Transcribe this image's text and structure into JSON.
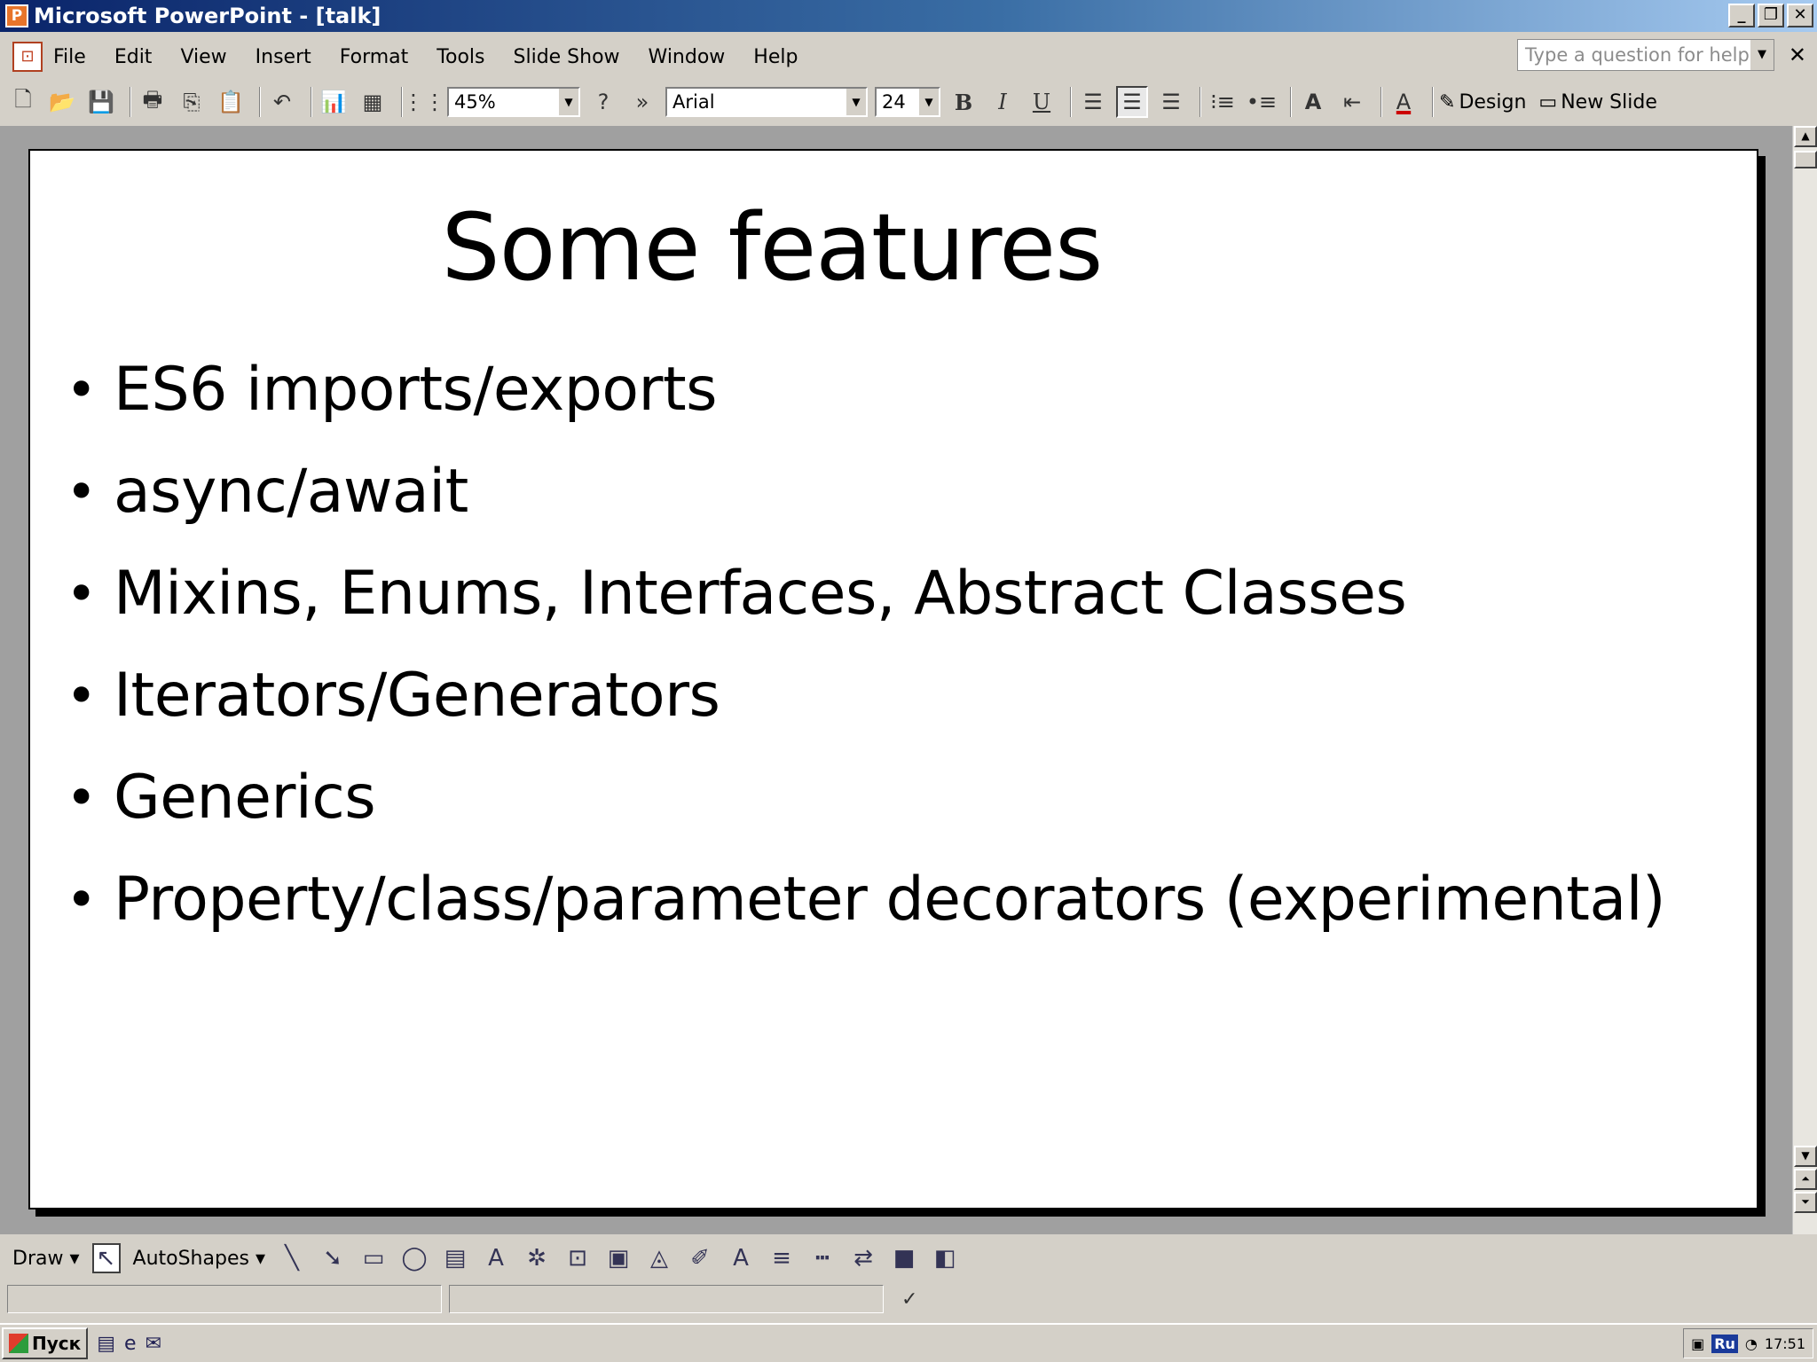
{
  "window": {
    "title": "Microsoft PowerPoint - [talk]",
    "app_icon": "powerpoint-icon",
    "controls": [
      "minimize-icon",
      "restore-icon",
      "close-icon"
    ]
  },
  "menubar": {
    "items": [
      "File",
      "Edit",
      "View",
      "Insert",
      "Format",
      "Tools",
      "Slide Show",
      "Window",
      "Help"
    ],
    "help_placeholder": "Type a question for help"
  },
  "toolbar": {
    "zoom": "45%",
    "font_name": "Arial",
    "font_size": "24",
    "design_label": "Design",
    "new_slide_label": "New Slide"
  },
  "slide": {
    "title": "Some features",
    "bullets": [
      "ES6 imports/exports",
      "async/await",
      "Mixins, Enums, Interfaces, Abstract Classes",
      "Iterators/Generators",
      "Generics",
      "Property/class/parameter decorators (experimental)"
    ]
  },
  "drawbar": {
    "draw_label": "Draw",
    "autoshapes_label": "AutoShapes"
  },
  "taskbar": {
    "start_label": "Пуск",
    "lang": "Ru",
    "clock": "17:51"
  },
  "colors": {
    "titlebar_start": "#0a246a",
    "titlebar_end": "#a6caf0",
    "chrome": "#d4d0c8",
    "workspace": "#a0a0a0"
  }
}
